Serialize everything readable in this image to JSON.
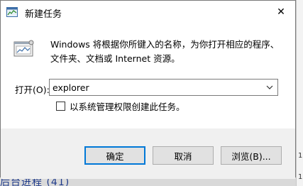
{
  "window": {
    "title": "新建任务",
    "close_glyph": "✕"
  },
  "description": {
    "line1": "Windows 将根据你所键入的名称，为你打开相应的程序、",
    "line2": "文件夹、文档或 Internet 资源。"
  },
  "open_field": {
    "label": "打开(O):",
    "value": "explorer"
  },
  "admin_option": {
    "label": "以系统管理权限创建此任务。",
    "checked": false
  },
  "buttons": {
    "ok_label": "确定",
    "cancel_label": "取消",
    "browse_label": "浏览(B)..."
  },
  "background": {
    "strip_top": "1",
    "strip_bottom": "1",
    "under_text": "后台进程 (41)"
  },
  "colors": {
    "focus_accent": "#0078d7",
    "footer_bg": "#f0f0f0"
  },
  "icons": [
    "task-manager-icon",
    "close-icon",
    "run-program-icon",
    "dropdown-arrow-icon"
  ]
}
